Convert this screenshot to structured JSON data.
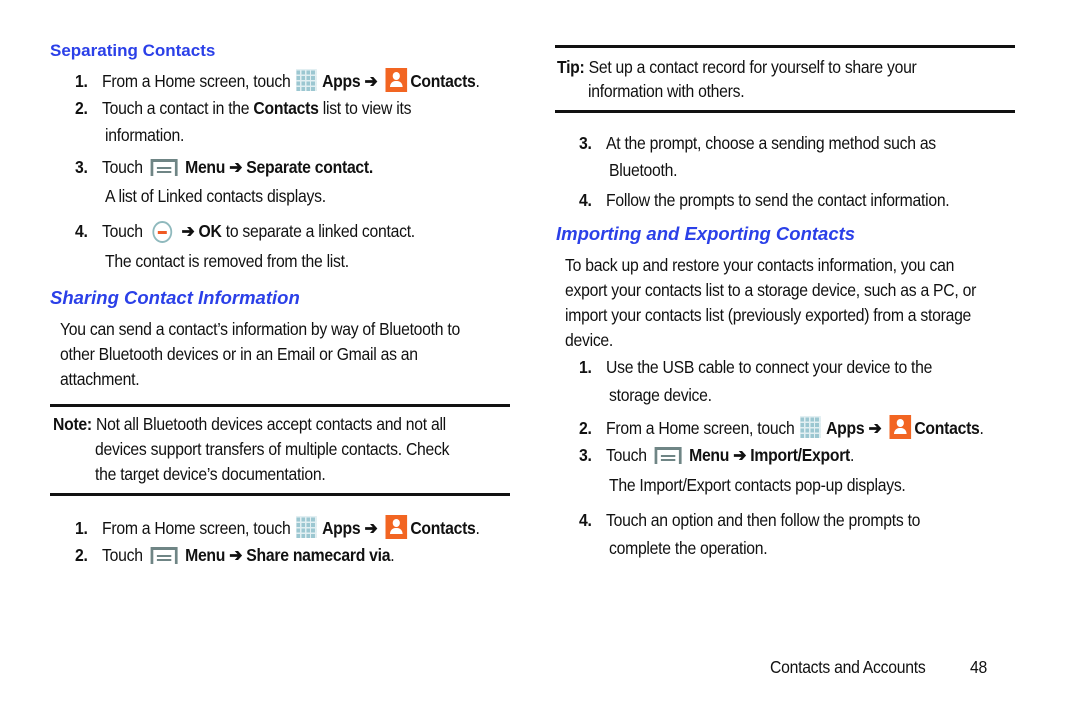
{
  "left": {
    "separating": {
      "heading": "Separating Contacts",
      "steps": [
        {
          "num": "1.",
          "pre": "From a Home screen, touch",
          "apps": "Apps",
          "arrow": "➔",
          "contacts": "Contacts",
          "post": "."
        },
        {
          "num": "2.",
          "pre": "Touch a contact in the",
          "bold": "Contacts",
          "post": "list to view its",
          "line2": "information."
        },
        {
          "num": "3.",
          "pre": "Touch",
          "menu": "Menu",
          "arrow": "➔",
          "target": "Separate contact.",
          "sub": "A list of Linked contacts displays."
        },
        {
          "num": "4.",
          "pre": "Touch",
          "arrow": "➔",
          "ok": "OK",
          "post": "to separate a linked contact.",
          "sub": "The contact is removed from the list."
        }
      ]
    },
    "sharing": {
      "heading": "Sharing Contact Information",
      "para_lines": [
        "You can send a contact’s information by way of Bluetooth to",
        "other Bluetooth devices or in an Email or Gmail as an",
        "attachment."
      ],
      "note_label": "Note:",
      "note_lines": [
        "Not all Bluetooth devices accept contacts and not all",
        "devices support transfers of multiple contacts. Check",
        "the target device’s documentation."
      ],
      "steps": [
        {
          "num": "1.",
          "pre": "From a Home screen, touch",
          "apps": "Apps",
          "arrow": "➔",
          "contacts": "Contacts",
          "post": "."
        },
        {
          "num": "2.",
          "pre": "Touch",
          "menu": "Menu",
          "arrow": "➔",
          "target": "Share namecard via",
          "post": "."
        }
      ]
    }
  },
  "right": {
    "tip_label": "Tip:",
    "tip_lines": [
      "Set up a contact record for yourself to share your",
      "information with others."
    ],
    "steps": [
      {
        "num": "3.",
        "line1": "At the prompt, choose a sending method such as",
        "line2": "Bluetooth."
      },
      {
        "num": "4.",
        "line1": "Follow the prompts to send the contact information."
      }
    ],
    "importing": {
      "heading": "Importing and Exporting Contacts",
      "para_lines": [
        "To back up and restore your contacts information, you can",
        "export your contacts list to a storage device, such as a PC, or",
        "import your contacts list (previously exported) from a storage",
        "device."
      ],
      "steps": [
        {
          "num": "1.",
          "line1": "Use the USB cable to connect your device to the",
          "line2": "storage device."
        },
        {
          "num": "2.",
          "pre": "From a Home screen, touch",
          "apps": "Apps",
          "arrow": "➔",
          "contacts": "Contacts",
          "post": "."
        },
        {
          "num": "3.",
          "pre": "Touch",
          "menu": "Menu",
          "arrow": "➔",
          "target": "Import/Export",
          "post": ".",
          "sub": "The Import/Export contacts pop-up displays."
        },
        {
          "num": "4.",
          "line1": "Touch an option and then follow the prompts to",
          "line2": "complete the operation."
        }
      ]
    }
  },
  "footer": {
    "section": "Contacts and Accounts",
    "page": "48"
  }
}
